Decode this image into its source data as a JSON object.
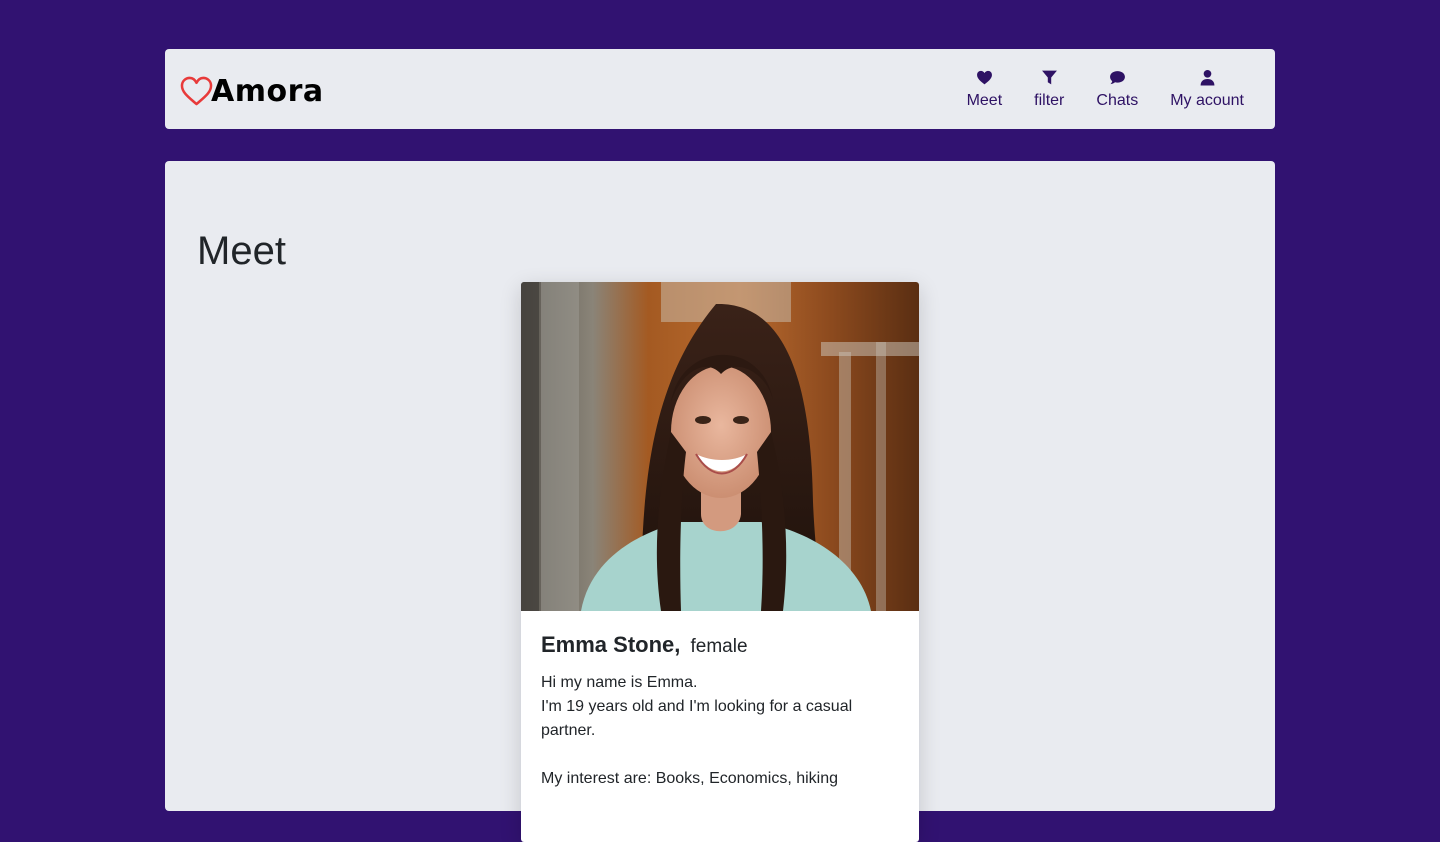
{
  "brand": {
    "name": "Amora",
    "heart_color": "#e83a3a"
  },
  "nav": {
    "items": [
      {
        "label": "Meet",
        "icon": "heart-icon"
      },
      {
        "label": "filter",
        "icon": "filter-icon"
      },
      {
        "label": "Chats",
        "icon": "chat-bubble-icon"
      },
      {
        "label": "My acount",
        "icon": "user-icon"
      }
    ]
  },
  "main": {
    "title": "Meet"
  },
  "profile": {
    "name": "Emma Stone,",
    "gender": "female",
    "bio_line1": "Hi my name is Emma.",
    "bio_line2": "I'm 19 years old and I'm looking for a casual partner.",
    "interests": "My interest are: Books, Economics, hiking"
  },
  "colors": {
    "background": "#311271",
    "panel": "#e9ebf0",
    "accent": "#2e1264"
  }
}
